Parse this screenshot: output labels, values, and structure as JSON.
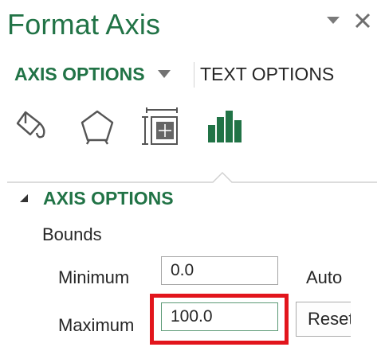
{
  "pane": {
    "title": "Format Axis",
    "controls": {
      "options_icon": "dropdown-triangle-icon",
      "close_icon": "close-icon"
    }
  },
  "tabs": {
    "axis_options": "AXIS OPTIONS",
    "text_options": "TEXT OPTIONS",
    "active": "axis_options"
  },
  "icon_row": [
    {
      "name": "fill-line-icon"
    },
    {
      "name": "effects-icon"
    },
    {
      "name": "size-properties-icon"
    },
    {
      "name": "axis-options-icon",
      "active": true
    }
  ],
  "section": {
    "title": "AXIS OPTIONS",
    "expanded": true,
    "bounds_label": "Bounds",
    "minimum": {
      "label": "Minimum",
      "value": "0.0",
      "state_label": "Auto"
    },
    "maximum": {
      "label": "Maximum",
      "value": "100.0",
      "button_label": "Reset",
      "highlighted": true
    }
  },
  "colors": {
    "accent_green": "#217346",
    "highlight_red": "#e2151c",
    "text": "#262626",
    "border": "#a6a6a6"
  }
}
